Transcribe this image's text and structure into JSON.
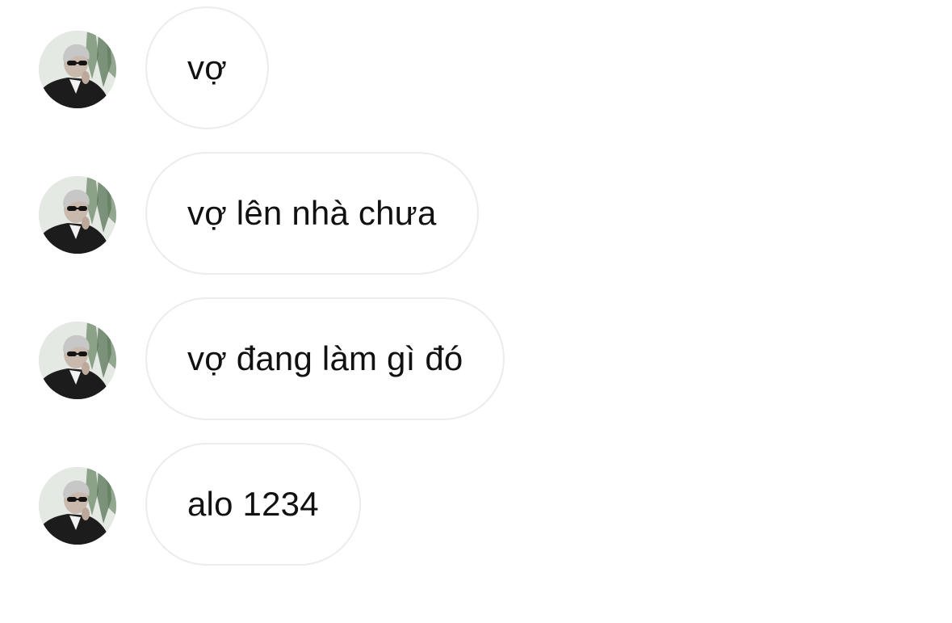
{
  "colors": {
    "background": "#ffffff",
    "bubble_border": "#ececec",
    "text": "#111111"
  },
  "messages": [
    {
      "text": "vợ",
      "avatar_icon": "contact-avatar"
    },
    {
      "text": "vợ lên nhà chưa",
      "avatar_icon": "contact-avatar"
    },
    {
      "text": "vợ đang làm gì đó",
      "avatar_icon": "contact-avatar"
    },
    {
      "text": "alo 1234",
      "avatar_icon": "contact-avatar"
    }
  ]
}
